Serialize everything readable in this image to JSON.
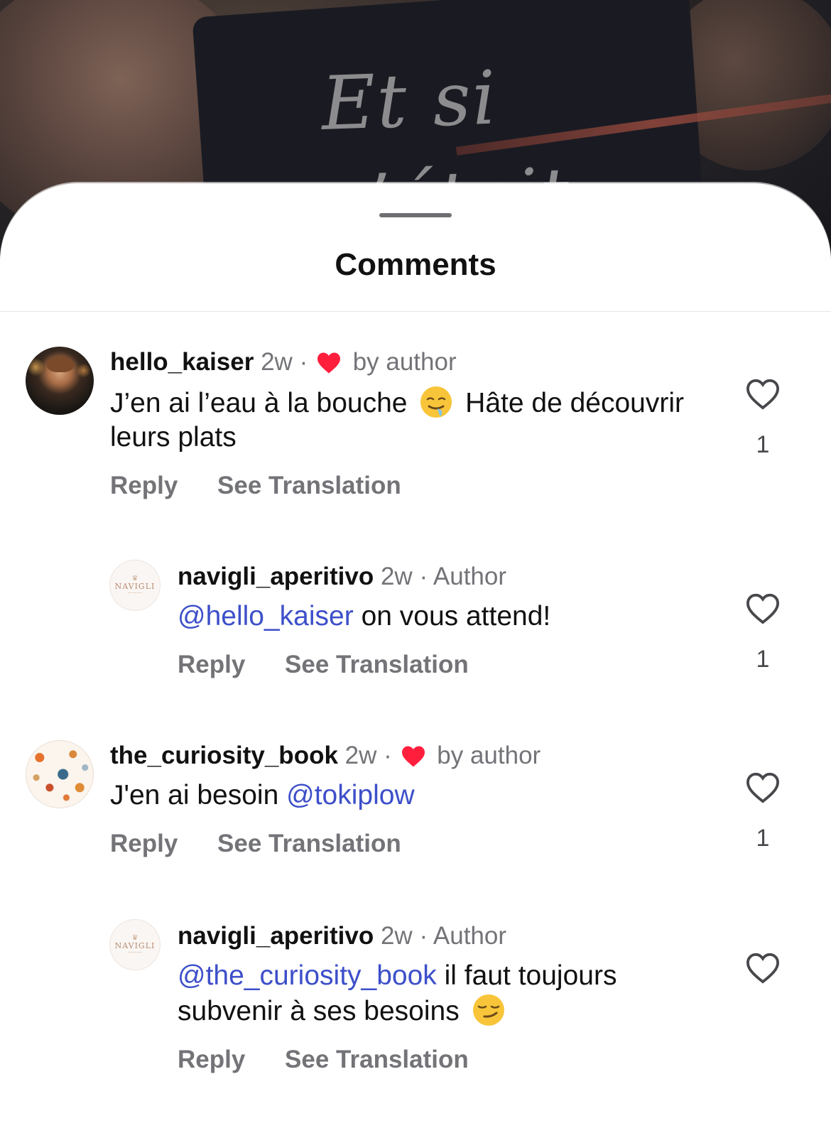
{
  "post": {
    "overlay_text": "Et si\nc’était"
  },
  "sheet": {
    "title": "Comments"
  },
  "comments": [
    {
      "username": "hello_kaiser",
      "time": "2w",
      "separator": "·",
      "badge": "by author",
      "text_before": "J’en ai l’eau à la bouche",
      "emoji": "drooling-face-emoji",
      "text_after": "Hâte de découvrir leurs plats",
      "mention": "",
      "reply_label": "Reply",
      "translate_label": "See Translation",
      "like_count": "1"
    },
    {
      "username": "navigli_aperitivo",
      "time": "2w",
      "separator": "·",
      "badge": "Author",
      "mention": "@hello_kaiser",
      "text_after": "on vous attend!",
      "reply_label": "Reply",
      "translate_label": "See Translation",
      "like_count": "1",
      "avatar_text": "NAVIGLI"
    },
    {
      "username": "the_curiosity_book",
      "time": "2w",
      "separator": "·",
      "badge": "by author",
      "text_before": "J'en ai besoin",
      "mention": "@tokiplow",
      "reply_label": "Reply",
      "translate_label": "See Translation",
      "like_count": "1"
    },
    {
      "username": "navigli_aperitivo",
      "time": "2w",
      "separator": "·",
      "badge": "Author",
      "mention": "@the_curiosity_book",
      "text_after": "il faut toujours subvenir à ses besoins",
      "emoji": "smirking-face-emoji",
      "reply_label": "Reply",
      "translate_label": "See Translation",
      "like_count": "",
      "avatar_text": "NAVIGLI"
    }
  ],
  "colors": {
    "mention": "#3d4fc9",
    "heart_red": "#ff1f3d",
    "muted_text": "#737378"
  }
}
